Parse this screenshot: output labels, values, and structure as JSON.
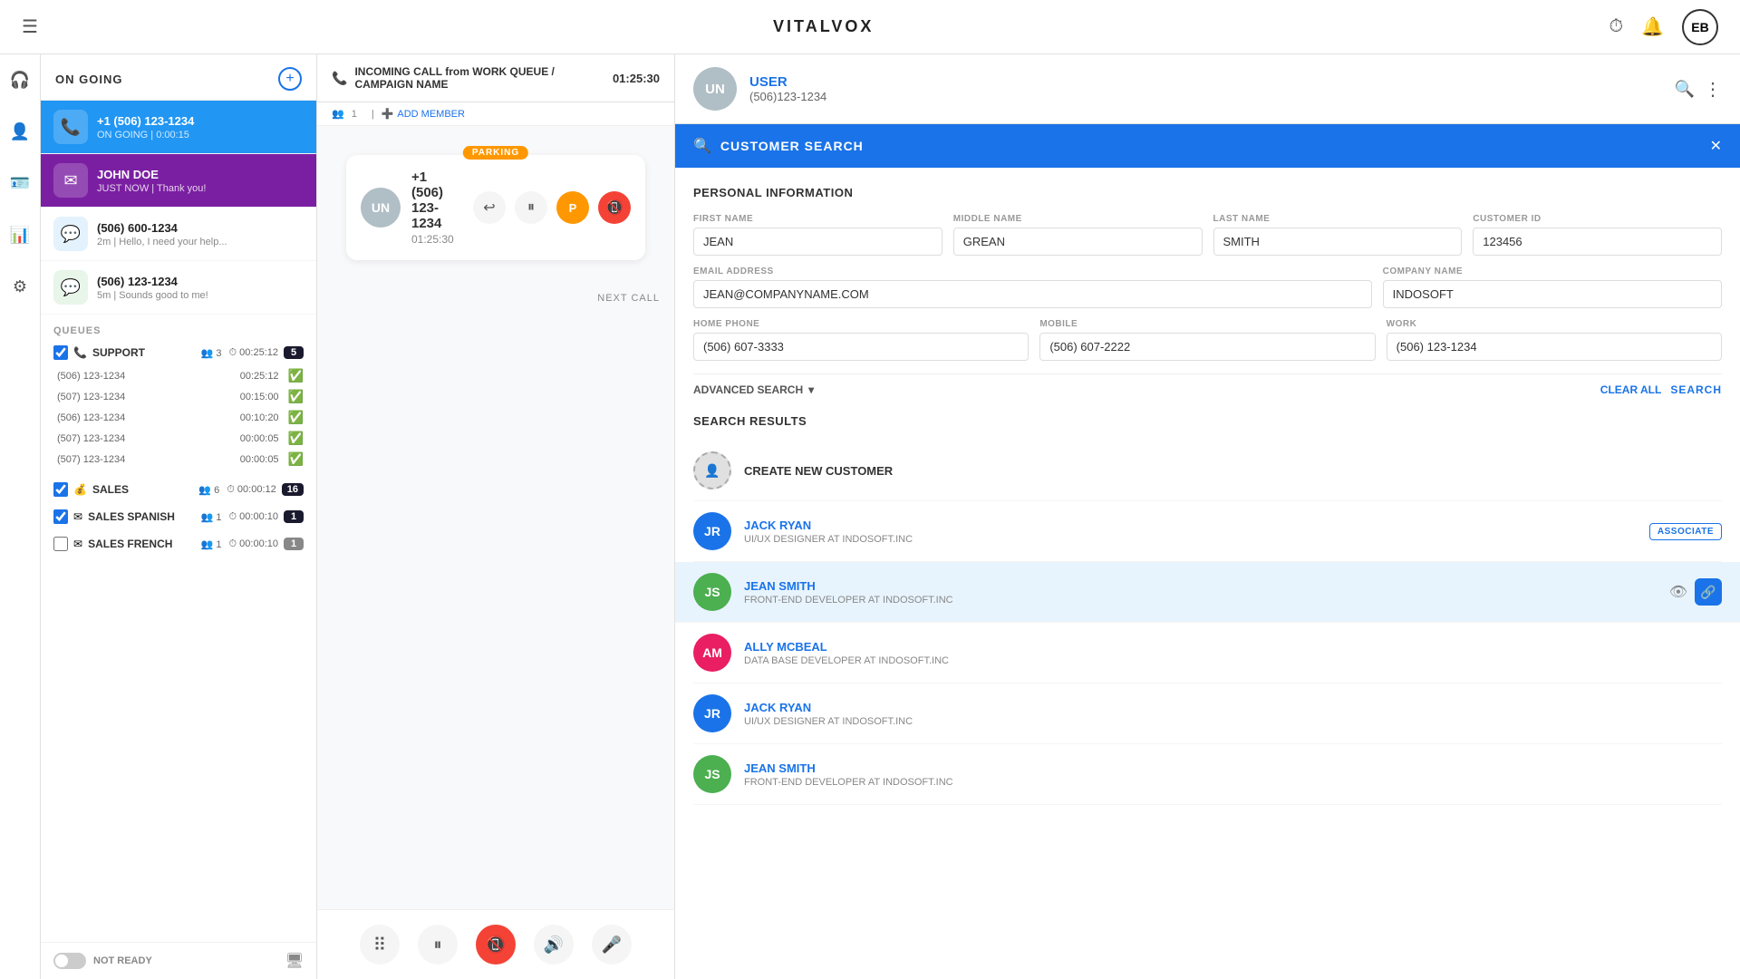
{
  "app": {
    "title": "VITALVOX",
    "user_initials": "EB"
  },
  "topnav": {
    "history_icon": "⏱",
    "bell_icon": "🔔",
    "menu_icon": "☰"
  },
  "sidebar": {
    "items": [
      {
        "id": "phone",
        "icon": "🎧",
        "active": true
      },
      {
        "id": "contacts",
        "icon": "👤"
      },
      {
        "id": "id-card",
        "icon": "🪪"
      },
      {
        "id": "chart",
        "icon": "📊"
      },
      {
        "id": "settings",
        "icon": "⚙"
      }
    ]
  },
  "left_panel": {
    "ongoing_title": "ON GOING",
    "add_btn": "+",
    "conversations": [
      {
        "id": "conv1",
        "type": "active-call",
        "icon": "📞",
        "name": "+1 (506) 123-1234",
        "status": "ON GOING",
        "time": "0:00:15"
      },
      {
        "id": "conv2",
        "type": "email",
        "icon": "✉",
        "name": "JOHN DOE",
        "status": "JUST NOW",
        "preview": "Thank you!"
      },
      {
        "id": "conv3",
        "type": "chat",
        "icon": "💬",
        "name": "(506) 600-1234",
        "status": "2m",
        "preview": "Hello, I need your help..."
      },
      {
        "id": "conv4",
        "type": "chat2",
        "icon": "💬",
        "name": "(506) 123-1234",
        "status": "5m",
        "preview": "Sounds good to me!"
      }
    ],
    "queues_label": "QUEUES",
    "queues": [
      {
        "id": "support",
        "name": "SUPPORT",
        "icon": "📞",
        "members": 3,
        "time": "00:25:12",
        "badge": 5,
        "rows": [
          {
            "phone": "(506) 123-1234",
            "time": "00:25:12",
            "status": "check"
          },
          {
            "phone": "(507) 123-1234",
            "time": "00:15:00",
            "status": "check"
          },
          {
            "phone": "(506) 123-1234",
            "time": "00:10:20",
            "status": "check"
          },
          {
            "phone": "(507) 123-1234",
            "time": "00:00:05",
            "status": "check"
          },
          {
            "phone": "(507) 123-1234",
            "time": "00:00:05",
            "status": "check"
          }
        ]
      },
      {
        "id": "sales",
        "name": "SALES",
        "icon": "💰",
        "members": 6,
        "time": "00:00:12",
        "badge": 16
      },
      {
        "id": "sales-spanish",
        "name": "SALES SPANISH",
        "icon": "✉",
        "members": 1,
        "time": "00:00:10",
        "badge": 1
      },
      {
        "id": "sales-french",
        "name": "SALES FRENCH",
        "icon": "✉",
        "members": 1,
        "time": "00:00:10",
        "badge": 1,
        "unchecked": true
      }
    ],
    "not_ready_label": "NOT READY"
  },
  "middle_panel": {
    "incoming_label": "INCOMING CALL from WORK QUEUE / CAMPAIGN NAME",
    "call_timer": "01:25:30",
    "participants": "1",
    "add_member_label": "ADD MEMBER",
    "parking_label": "PARKING",
    "call_number": "+1 (506) 123-1234",
    "call_time": "01:25:30",
    "next_call_label": "NEXT CALL",
    "controls": {
      "dialpad": "⠿",
      "hold": "⏸",
      "hangup": "📵",
      "volume": "🔊",
      "mic": "🎤"
    }
  },
  "right_panel": {
    "user_initials": "UN",
    "user_name": "USER",
    "user_phone": "(506)123-1234",
    "customer_search": {
      "title": "CUSTOMER SEARCH",
      "personal_info_title": "PERSONAL INFORMATION",
      "fields": {
        "first_name_label": "FIRST NAME",
        "first_name_value": "JEAN",
        "middle_name_label": "MIDDLE NAME",
        "middle_name_value": "GREAN",
        "last_name_label": "LAST NAME",
        "last_name_value": "SMITH",
        "customer_id_label": "CUSTOMER ID",
        "customer_id_value": "123456",
        "email_label": "EMAIL ADDRESS",
        "email_value": "JEAN@COMPANYNAME.COM",
        "company_label": "COMPANY NAME",
        "company_value": "INDOSOFT",
        "home_phone_label": "HOME PHONE",
        "home_phone_value": "(506) 607-3333",
        "mobile_label": "MOBILE",
        "mobile_value": "(506) 607-2222",
        "work_label": "WORK",
        "work_value": "(506) 123-1234"
      },
      "advanced_search_label": "ADVANCED SEARCH",
      "clear_label": "CLEAR ALL",
      "search_label": "SEARCH",
      "results_title": "SEARCH RESULTS",
      "results": [
        {
          "id": "new",
          "type": "new",
          "initials": "+",
          "name": "CREATE NEW CUSTOMER",
          "role": ""
        },
        {
          "id": "jr1",
          "type": "jr",
          "initials": "JR",
          "name": "JACK RYAN",
          "role": "UI/UX DESIGNER AT INDOSOFT.INC",
          "badge": "ASSOCIATE"
        },
        {
          "id": "js1",
          "type": "js",
          "initials": "JS",
          "name": "JEAN SMITH",
          "role": "FRONT-END DEVELOPER AT INDOSOFT.INC",
          "highlighted": true
        },
        {
          "id": "am",
          "type": "am",
          "initials": "AM",
          "name": "ALLY MCBEAL",
          "role": "DATA BASE DEVELOPER AT INDOSOFT.INC"
        },
        {
          "id": "jr2",
          "type": "jr",
          "initials": "JR",
          "name": "JACK RYAN",
          "role": "UI/UX DESIGNER AT INDOSOFT.INC"
        },
        {
          "id": "js2",
          "type": "js",
          "initials": "JS",
          "name": "JEAN SMITH",
          "role": "FRONT-END DEVELOPER AT INDOSOFT.INC"
        }
      ]
    }
  }
}
